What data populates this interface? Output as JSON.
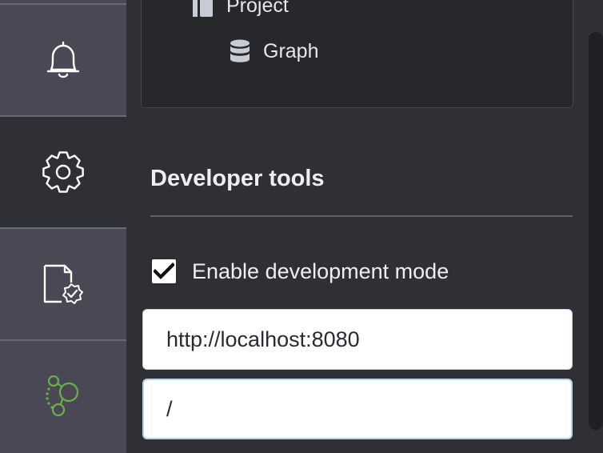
{
  "sidebar": {
    "items": [
      {
        "name": "notifications",
        "icon": "bell-icon"
      },
      {
        "name": "settings",
        "icon": "gear-icon",
        "active": true
      },
      {
        "name": "license",
        "icon": "file-check-icon"
      },
      {
        "name": "graph-apps",
        "icon": "graph-logo-icon"
      }
    ]
  },
  "tree": {
    "items": [
      {
        "label": "Project",
        "icon": "folder-icon"
      },
      {
        "label": "Graph",
        "icon": "database-icon"
      }
    ]
  },
  "developer_tools": {
    "title": "Developer tools",
    "enable_dev_mode": {
      "label": "Enable development mode",
      "checked": true
    },
    "url_input": {
      "value": "http://localhost:8080"
    },
    "path_input": {
      "value": "/"
    }
  },
  "colors": {
    "sidebar_bg": "#4a4854",
    "main_bg": "#2f3035",
    "accent_green": "#6ab04c",
    "focus_border": "#b6d3ea"
  }
}
